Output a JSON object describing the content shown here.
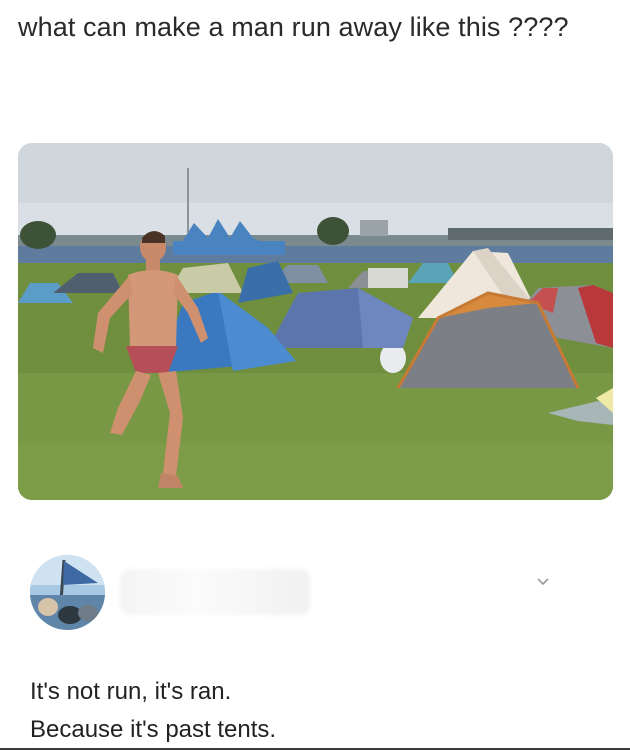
{
  "post": {
    "caption": "what can make a man  run away like this ????",
    "photo_icon": "photo-image"
  },
  "comment": {
    "avatar_icon": "avatar-image",
    "username": "",
    "menu_icon": "chevron-down-icon",
    "lines": [
      "It's not run, it's ran.",
      "Because it's past tents."
    ]
  }
}
